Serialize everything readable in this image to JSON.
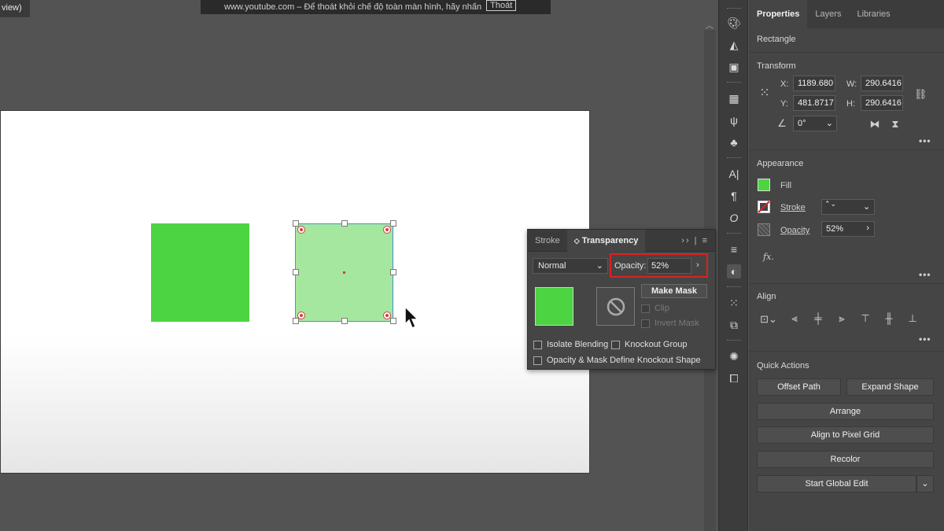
{
  "doc_tab": "view)",
  "fullscreen_banner": {
    "text": "www.youtube.com – Để thoát khỏi chế độ toàn màn hình, hãy nhấn",
    "exit_button": "Thoát"
  },
  "colors": {
    "fill_green": "#4cd442",
    "fill_green_52": "#a6e79f",
    "highlight": "#e02020"
  },
  "transparency_panel": {
    "tabs": [
      "Stroke",
      "Transparency"
    ],
    "active_tab": "Transparency",
    "blend_mode": "Normal",
    "opacity_label": "Opacity:",
    "opacity_value": "52%",
    "make_mask": "Make Mask",
    "clip": "Clip",
    "invert_mask": "Invert Mask",
    "isolate_blending": "Isolate Blending",
    "knockout_group": "Knockout Group",
    "opacity_mask_knockout": "Opacity & Mask Define Knockout Shape"
  },
  "properties": {
    "tabs": [
      "Properties",
      "Layers",
      "Libraries"
    ],
    "object_type": "Rectangle",
    "transform": {
      "title": "Transform",
      "x_label": "X:",
      "x": "1189.680",
      "y_label": "Y:",
      "y": "481.8717",
      "w_label": "W:",
      "w": "290.6416",
      "h_label": "H:",
      "h": "290.6416",
      "angle": "0°"
    },
    "appearance": {
      "title": "Appearance",
      "fill": "Fill",
      "stroke": "Stroke",
      "opacity": "Opacity",
      "opacity_value": "52%",
      "fx": "fx."
    },
    "align": {
      "title": "Align"
    },
    "quick_actions": {
      "title": "Quick Actions",
      "offset_path": "Offset Path",
      "expand_shape": "Expand Shape",
      "arrange": "Arrange",
      "align_pixel_grid": "Align to Pixel Grid",
      "recolor": "Recolor",
      "start_global_edit": "Start Global Edit"
    }
  }
}
